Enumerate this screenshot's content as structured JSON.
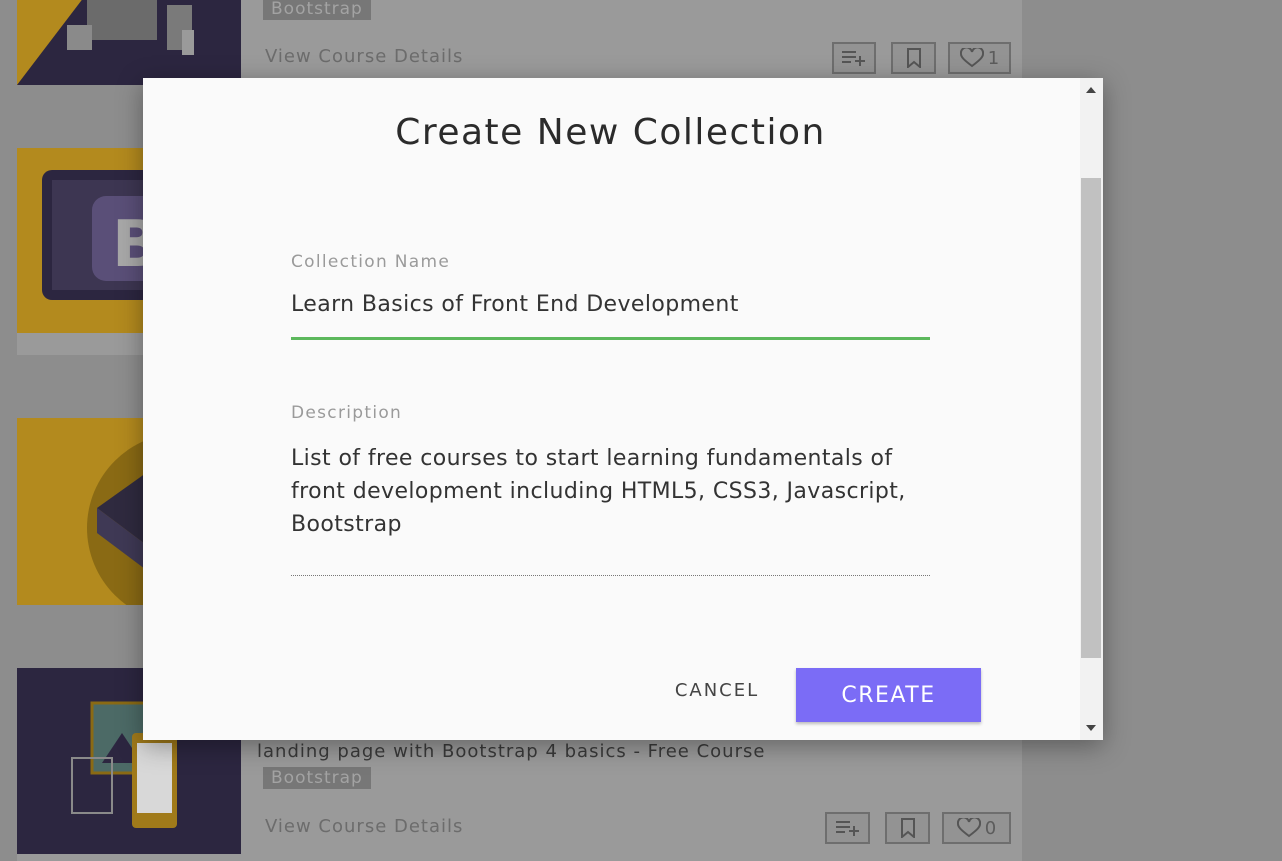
{
  "background": {
    "cards": [
      {
        "title": "",
        "tag": "Bootstrap",
        "view_link": "View Course Details",
        "likes": "1"
      },
      {
        "title": "landing page with Bootstrap 4 basics - Free Course",
        "tag": "Bootstrap",
        "view_link": "View Course Details",
        "likes": "0"
      }
    ],
    "icons": {
      "playlist_add": "playlist-add-icon",
      "bookmark": "bookmark-icon",
      "heart": "heart-icon"
    }
  },
  "modal": {
    "title": "Create New Collection",
    "name_field": {
      "label": "Collection Name",
      "value": "Learn Basics of Front End Development"
    },
    "description_field": {
      "label": "Description",
      "value": "List of free courses to start learning fundamentals of front development including HTML5, CSS3, Javascript, Bootstrap"
    },
    "cancel_label": "CANCEL",
    "create_label": "CREATE",
    "colors": {
      "accent": "#7b6cf6",
      "focus_underline": "#5cb85c"
    }
  }
}
